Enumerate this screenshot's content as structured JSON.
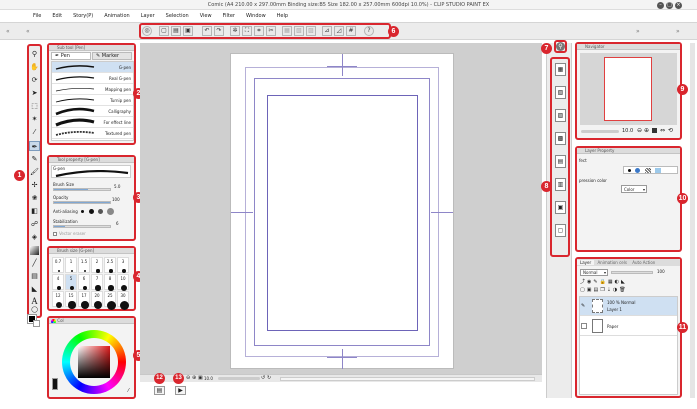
{
  "window": {
    "title": "Comic (A4 210.00 x 297.00mm Binding size:B5 Size 182.00 x 257.00mm 600dpi 10.0%) - CLIP STUDIO PAINT EX"
  },
  "menu": [
    "File",
    "Edit",
    "Story(P)",
    "Animation",
    "Layer",
    "Selection",
    "View",
    "Filter",
    "Window",
    "Help"
  ],
  "subtool": {
    "tabs": [
      "Pen",
      "Marker"
    ],
    "brushes": [
      "G-pen",
      "Real G-pen",
      "Mapping pen",
      "Turnip pen",
      "Calligraphy",
      "For effect line",
      "Textured pen"
    ]
  },
  "toolprop": {
    "title": "Tool property [G-pen]",
    "name": "G-pen",
    "brush_size_label": "Brush Size",
    "brush_size_value": "5.0",
    "opacity_label": "Opacity",
    "opacity_value": "100",
    "antialiasing_label": "Anti-aliasing",
    "stabilization_label": "Stabilization",
    "stabilization_value": "6",
    "vector_eraser_label": "Vector eraser"
  },
  "brushsize": {
    "title": "Brush size [G-pen]",
    "sizes": [
      "0.7",
      "1",
      "1.5",
      "2",
      "2.5",
      "3",
      "4",
      "5",
      "6",
      "7",
      "8",
      "10",
      "12",
      "15",
      "17",
      "20",
      "25",
      "30"
    ]
  },
  "color": {
    "tab": "Col"
  },
  "navigator": {
    "title": "Navigator",
    "zoom": "10.0"
  },
  "layerprop": {
    "title": "Layer Property",
    "effect_label": "fect",
    "expression_label": "pression color",
    "color_value": "Color"
  },
  "layer": {
    "tabs": [
      "Layer",
      "Animation cels",
      "Auto Action"
    ],
    "blend_mode": "Normal",
    "opacity": "100",
    "layers": [
      {
        "mode": "100 % Normal",
        "name": "Layer 1"
      },
      {
        "mode": "",
        "name": "Paper"
      }
    ]
  },
  "status": {
    "zoom": "10.0"
  },
  "callouts": [
    "1",
    "2",
    "3",
    "4",
    "5",
    "6",
    "7",
    "8",
    "9",
    "10",
    "11",
    "12",
    "13"
  ],
  "colors": {
    "accent": "#d9262e",
    "titlebar": "#f4f4f4",
    "canvas_bg": "#cfcfcf"
  }
}
